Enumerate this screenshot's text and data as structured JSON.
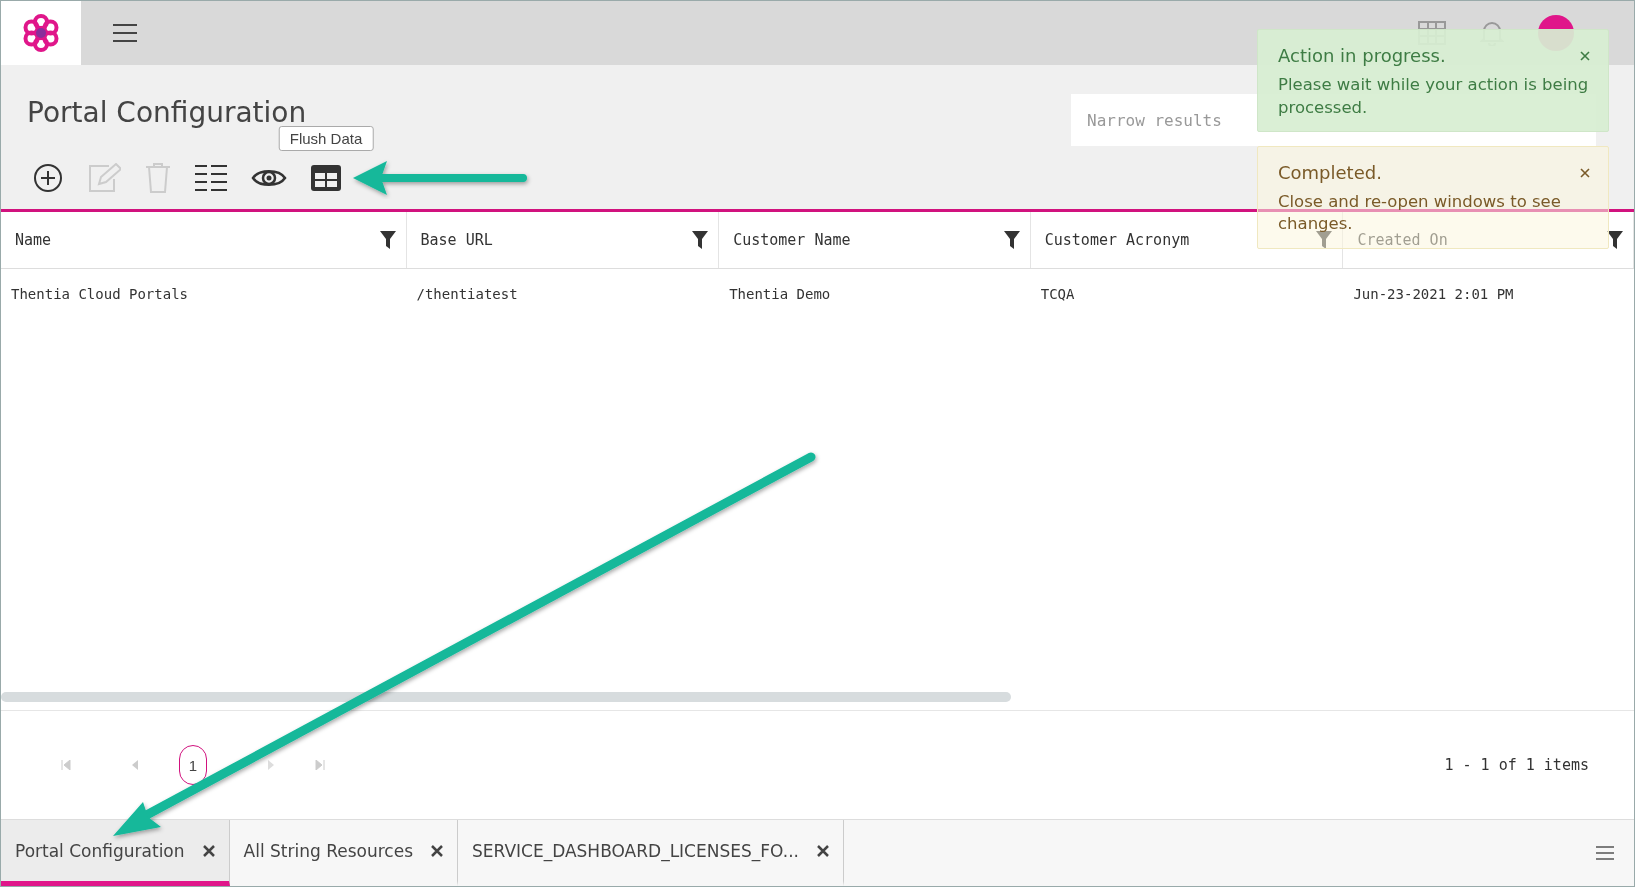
{
  "page": {
    "title": "Portal Configuration"
  },
  "toolbar": [
    {
      "kind": "add",
      "disabled": false
    },
    {
      "kind": "edit",
      "disabled": true
    },
    {
      "kind": "delete",
      "disabled": true
    },
    {
      "kind": "columns",
      "disabled": false
    },
    {
      "kind": "view",
      "disabled": false
    },
    {
      "kind": "flush",
      "disabled": false,
      "tooltip": "Flush Data"
    }
  ],
  "search": {
    "placeholder": "Narrow results"
  },
  "table": {
    "columns": [
      {
        "label": "Name"
      },
      {
        "label": "Base URL"
      },
      {
        "label": "Customer Name"
      },
      {
        "label": "Customer Acronym"
      },
      {
        "label": "Created On"
      }
    ],
    "rows": [
      [
        "Thentia Cloud Portals",
        "/thentiatest",
        "Thentia Demo",
        "TCQA",
        "Jun-23-2021 2:01 PM"
      ]
    ]
  },
  "pager": {
    "pages": [
      {
        "label": "1",
        "selected": true
      }
    ],
    "summary": "1 - 1 of 1 items"
  },
  "toasts": [
    {
      "kind": "success",
      "title": "Action in progress.",
      "message": "Please wait while your action is being processed."
    },
    {
      "kind": "warning",
      "title": "Completed.",
      "message": "Close and re-open windows to see changes."
    }
  ],
  "tabs": [
    {
      "label": "Portal Configuration",
      "selected": true
    },
    {
      "label": "All String Resources",
      "selected": false
    },
    {
      "label": "SERVICE_DASHBOARD_LICENSES_FO...",
      "selected": false
    }
  ]
}
